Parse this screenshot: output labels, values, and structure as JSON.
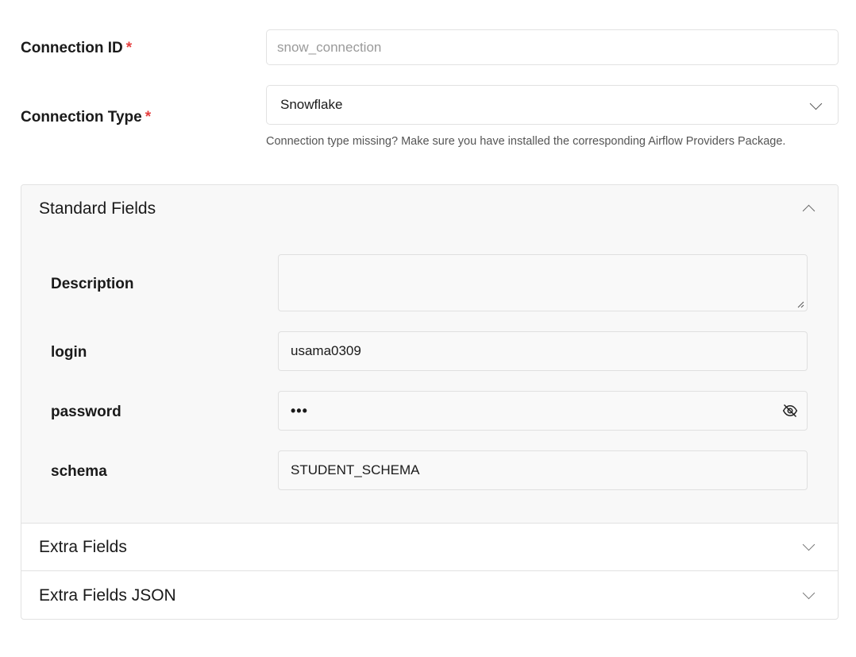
{
  "connection_id": {
    "label": "Connection ID",
    "required_mark": "*",
    "placeholder": "snow_connection"
  },
  "connection_type": {
    "label": "Connection Type",
    "required_mark": "*",
    "selected": "Snowflake",
    "helper_text": "Connection type missing? Make sure you have installed the corresponding Airflow Providers Package."
  },
  "standard_fields": {
    "title": "Standard Fields",
    "expanded": true,
    "fields": {
      "description": {
        "label": "Description",
        "value": ""
      },
      "login": {
        "label": "login",
        "value": "usama0309"
      },
      "password": {
        "label": "password",
        "value": "•••"
      },
      "schema": {
        "label": "schema",
        "value": "STUDENT_SCHEMA"
      }
    }
  },
  "extra_fields": {
    "title": "Extra Fields",
    "expanded": false
  },
  "extra_fields_json": {
    "title": "Extra Fields JSON",
    "expanded": false
  },
  "icons": {
    "password_toggle": "eye-off-icon",
    "select_chevron": "chevron-down-icon",
    "accordion_open": "chevron-up-icon",
    "accordion_closed": "chevron-down-icon"
  },
  "colors": {
    "required": "#e53e3e",
    "border": "#e2e2e2",
    "panel_bg": "#f8f8f8"
  }
}
